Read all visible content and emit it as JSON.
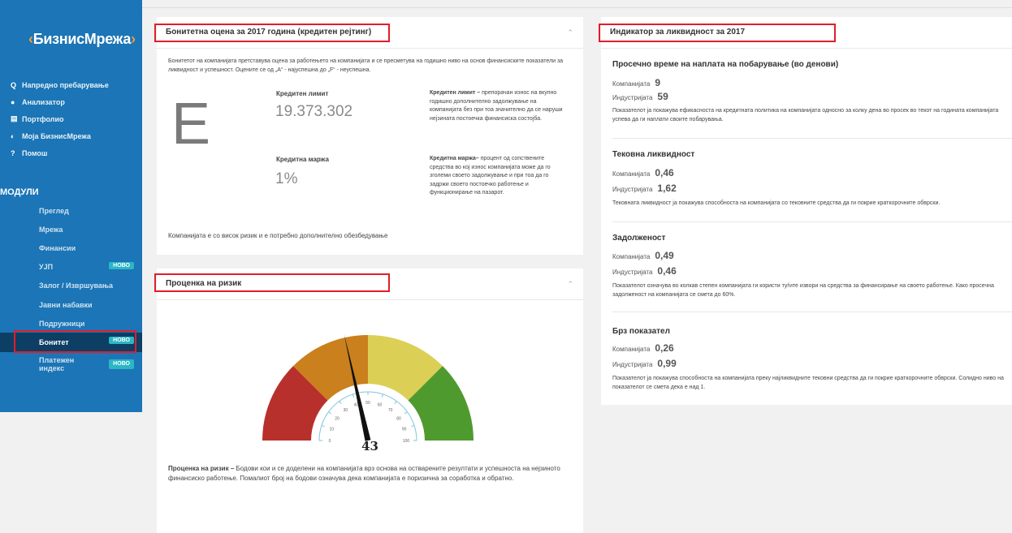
{
  "sidebar": {
    "logo": {
      "mark": "‹",
      "text": "БизнисМрежа",
      "tail": "›"
    },
    "nav": [
      {
        "icon": "Q",
        "label": "Напредно пребарување"
      },
      {
        "icon": "●",
        "label": "Анализатор"
      },
      {
        "icon": "▤",
        "label": "Портфолио"
      },
      {
        "icon": "◐",
        "label": "Моја БизнисМрежа"
      },
      {
        "icon": "?",
        "label": "Помош"
      }
    ],
    "modules_title": "МОДУЛИ",
    "modules": [
      {
        "label": "Преглед",
        "badge": ""
      },
      {
        "label": "Мрежа",
        "badge": ""
      },
      {
        "label": "Финансии",
        "badge": ""
      },
      {
        "label": "УЈП",
        "badge": "НОВО"
      },
      {
        "label": "Залог / Извршувања",
        "badge": ""
      },
      {
        "label": "Јавни набавки",
        "badge": ""
      },
      {
        "label": "Подружници",
        "badge": ""
      },
      {
        "label": "Бонитет",
        "badge": "НОВО"
      },
      {
        "label1": "Платежен",
        "label2": "индекс",
        "badge": "НОВО"
      }
    ]
  },
  "rating": {
    "title": "Бонитетна оцена за 2017 година (кредитен рејтинг)",
    "intro": "Бонитетот на компанијата претставува оцена за работењето на компанијата и се пресметува на годишно ниво на основ финансиските показатели за ликвидност и успешност. Оцените се од „А“ - најуспешна до „F“ - неуспешна.",
    "grade": "E",
    "credit_limit_label": "Кредитен лимит",
    "credit_limit_value": "19.373.302",
    "credit_margin_label": "Кредитна маржа",
    "credit_margin_value": "1%",
    "limit_desc_bold": "Кредитен лимит –",
    "limit_desc": " препорачан износ на вкупно годишно дополнително задолжување на компанијата без при тоа значително да се наруши нејзината постоечка финансиска состојба.",
    "margin_desc_bold": "Кредитна маржа–",
    "margin_desc": " процент од сопствените средства во кој износ компанијата може да го зголеми своето задолжување и при тоа да го задржи своето постоечко работење и функционирање на пазарот.",
    "footer": "Компанијата е со висок ризик и е потребно дополнително обезбедување"
  },
  "risk": {
    "title": "Проценка на ризик",
    "value": "43",
    "gauge_value": 43,
    "ticks": [
      "0",
      "10",
      "20",
      "30",
      "40",
      "50",
      "60",
      "70",
      "80",
      "90",
      "100"
    ],
    "desc_bold": "Проценка на ризик –",
    "desc": " Бодови кои и се доделени на компанијата врз основа на остварените резултати и успешноста на нејзиното финансиско работење. Помалиот број на бодови означува дека компанијата е поризична за соработка и обратно."
  },
  "liquidity": {
    "title": "Индикатор за ликвидност за 2017",
    "sections": [
      {
        "title": "Просечно време на наплата на побарување (во денови)",
        "company_label": "Компанијата",
        "company": "9",
        "industry_label": "Индустријата",
        "industry": "59",
        "desc": "Показателот ја покажува ефикасноста на кредитната политика на компанијата односно за колку дена во просек во текот на годината компанијата успева да ги наплати своите побарувања."
      },
      {
        "title": "Тековна ликвидност",
        "company_label": "Компанијата",
        "company": "0,46",
        "industry_label": "Индустријата",
        "industry": "1,62",
        "desc": "Тековната ликвидност ја покажува способноста на компанијата со тековните средства да ги покрие краткорочните обврски."
      },
      {
        "title": "Задолженост",
        "company_label": "Компанијата",
        "company": "0,49",
        "industry_label": "Индустријата",
        "industry": "0,46",
        "desc": "Показателот означува во колкав степен компанијата ги користи туѓите извори на средства за финансирање на своето работење. Како просечна задолженост на компанијата се смета до 60%."
      },
      {
        "title": "Брз показател",
        "company_label": "Компанијата",
        "company": "0,26",
        "industry_label": "Индустријата",
        "industry": "0,99",
        "desc": "Показателот ја покажува способноста на компанијата преку најликвидните тековни средства да ги покрие краткорочните обврски. Солидно ниво на показателот се смета дека е над 1."
      }
    ]
  },
  "colors": {
    "sidebar": "#1b75b6",
    "active": "#0d3e63",
    "badge": "#2ab6c5",
    "highlight": "#e11d2a"
  }
}
